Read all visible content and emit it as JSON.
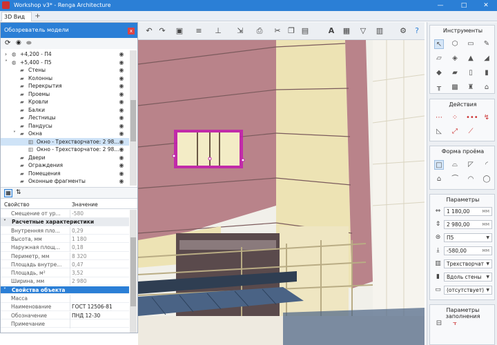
{
  "window": {
    "title": "Workshop v3* - Renga Architecture",
    "min_icon": "—",
    "max_icon": "□",
    "close_icon": "✕"
  },
  "tabs": {
    "active": "3D Вид",
    "add": "+"
  },
  "model_browser": {
    "title": "Обозреватель модели",
    "close": "x",
    "tree": [
      {
        "label": "+4,200 - П4",
        "level": 0,
        "expanded": false
      },
      {
        "label": "+5,400 - П5",
        "level": 0,
        "expanded": true
      },
      {
        "label": "Стены",
        "level": 1
      },
      {
        "label": "Колонны",
        "level": 1
      },
      {
        "label": "Перекрытия",
        "level": 1
      },
      {
        "label": "Проемы",
        "level": 1
      },
      {
        "label": "Кровли",
        "level": 1
      },
      {
        "label": "Балки",
        "level": 1
      },
      {
        "label": "Лестницы",
        "level": 1
      },
      {
        "label": "Пандусы",
        "level": 1
      },
      {
        "label": "Окна",
        "level": 1,
        "expanded": true
      },
      {
        "label": "Окно - Трехстворчатое: 2 98...",
        "level": 2,
        "selected": true
      },
      {
        "label": "Окно - Трехстворчатое: 2 98...",
        "level": 2
      },
      {
        "label": "Двери",
        "level": 1
      },
      {
        "label": "Ограждения",
        "level": 1
      },
      {
        "label": "Помещения",
        "level": 1
      },
      {
        "label": "Оконные фрагменты",
        "level": 1
      }
    ]
  },
  "properties": {
    "col_property": "Свойство",
    "col_value": "Значение",
    "rows": [
      {
        "type": "item",
        "key": "Смещение от ур...",
        "value": "-580",
        "dim": true
      },
      {
        "type": "group",
        "key": "Расчетные характеристики"
      },
      {
        "type": "item",
        "key": "Внутренняя пло...",
        "value": "0,29",
        "dim": true
      },
      {
        "type": "item",
        "key": "Высота, мм",
        "value": "1 180",
        "dim": true
      },
      {
        "type": "item",
        "key": "Наружная площ...",
        "value": "0,18",
        "dim": true
      },
      {
        "type": "item",
        "key": "Периметр, мм",
        "value": "8 320",
        "dim": true
      },
      {
        "type": "item",
        "key": "Площадь внутре...",
        "value": "0,47",
        "dim": true
      },
      {
        "type": "item",
        "key": "Площадь, м²",
        "value": "3,52",
        "dim": true
      },
      {
        "type": "item",
        "key": "Ширина, мм",
        "value": "2 980",
        "dim": true
      },
      {
        "type": "groupsel",
        "key": "Свойства объекта"
      },
      {
        "type": "item",
        "key": "Масса",
        "value": ""
      },
      {
        "type": "item",
        "key": "Наименование",
        "value": "ГОСТ 12506-81"
      },
      {
        "type": "item",
        "key": "Обозначение",
        "value": "ПНД 12-30"
      },
      {
        "type": "item",
        "key": "Примечание",
        "value": ""
      }
    ]
  },
  "right_panels": {
    "tools_title": "Инструменты",
    "actions_title": "Действия",
    "opening_title": "Форма проёма",
    "params_title": "Параметры",
    "params": [
      {
        "value": "1 180,00",
        "unit": "мм",
        "icon": "width-icon"
      },
      {
        "value": "2 980,00",
        "unit": "мм",
        "icon": "height-icon"
      },
      {
        "value": "П5",
        "dropdown": true,
        "icon": "level-icon"
      },
      {
        "value": "-580,00",
        "unit": "мм",
        "icon": "offset-icon"
      },
      {
        "value": "Трехстворчат",
        "dropdown": true,
        "icon": "window-style-icon"
      },
      {
        "value": "Вдоль стены",
        "dropdown": true,
        "icon": "alignment-icon"
      },
      {
        "value": "(отсутствует)",
        "dropdown": true,
        "icon": "material-icon"
      }
    ],
    "fill_title": "Параметры заполнения"
  },
  "colors": {
    "accent": "#2b7fd6",
    "wall_pink": "#b9838a",
    "wall_beige": "#ede3b4",
    "selection": "#c21cae"
  }
}
